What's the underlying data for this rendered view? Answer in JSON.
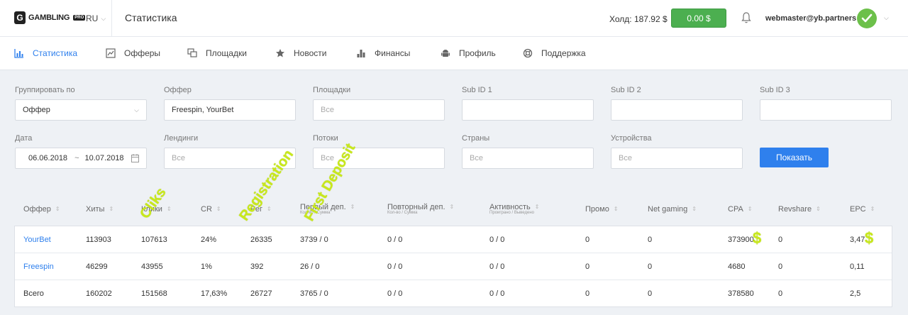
{
  "header": {
    "logo_text": "GAMBLING",
    "logo_badge": "PRO",
    "lang": "RU",
    "page_title": "Статистика",
    "hold": "Холд: 187.92 $",
    "balance": "0.00 $",
    "user": "webmaster@yb.partners"
  },
  "nav": [
    {
      "label": "Статистика",
      "icon": "bar-chart-icon"
    },
    {
      "label": "Офферы",
      "icon": "chart-window-icon"
    },
    {
      "label": "Площадки",
      "icon": "windows-icon"
    },
    {
      "label": "Новости",
      "icon": "star-icon"
    },
    {
      "label": "Финансы",
      "icon": "bars-icon"
    },
    {
      "label": "Профиль",
      "icon": "android-icon"
    },
    {
      "label": "Поддержка",
      "icon": "lifebuoy-icon"
    }
  ],
  "filters": {
    "group_by": {
      "label": "Группировать по",
      "value": "Оффер"
    },
    "offer": {
      "label": "Оффер",
      "value": "Freespin, YourBet"
    },
    "sites": {
      "label": "Площадки",
      "placeholder": "Все"
    },
    "sub1": {
      "label": "Sub ID 1"
    },
    "sub2": {
      "label": "Sub ID 2"
    },
    "sub3": {
      "label": "Sub ID 3"
    },
    "date": {
      "label": "Дата",
      "from": "06.06.2018",
      "sep": "~",
      "to": "10.07.2018"
    },
    "landings": {
      "label": "Лендинги",
      "placeholder": "Все"
    },
    "streams": {
      "label": "Потоки",
      "placeholder": "Все"
    },
    "countries": {
      "label": "Страны",
      "placeholder": "Все"
    },
    "devices": {
      "label": "Устройства",
      "placeholder": "Все"
    },
    "show_button": "Показать"
  },
  "table": {
    "headers": [
      "Оффер",
      "Хиты",
      "Клики",
      "CR",
      "Рег",
      "Первый деп.",
      "Повторный деп.",
      "Активность",
      "Промо",
      "Net gaming",
      "CPA",
      "Revshare",
      "EPC"
    ],
    "subheaders": {
      "first_dep": "Кол-во / Сумма",
      "repeat_dep": "Кол-во / Сумма",
      "activity": "Проиграно / Выведено"
    },
    "rows": [
      [
        "YourBet",
        "113903",
        "107613",
        "24%",
        "26335",
        "3739 / 0",
        "0 / 0",
        "0 / 0",
        "0",
        "0",
        "373900",
        "0",
        "3,47"
      ],
      [
        "Freespin",
        "46299",
        "43955",
        "1%",
        "392",
        "26 / 0",
        "0 / 0",
        "0 / 0",
        "0",
        "0",
        "4680",
        "0",
        "0,11"
      ],
      [
        "Всего",
        "160202",
        "151568",
        "17,63%",
        "26727",
        "3765 / 0",
        "0 / 0",
        "0 / 0",
        "0",
        "0",
        "378580",
        "0",
        "2,5"
      ]
    ]
  },
  "annotations": {
    "cliks": "Cliks",
    "registration": "Registration",
    "first_deposit": "First Deposit",
    "dollar": "$"
  },
  "colors": {
    "accent": "#2f80ed",
    "success": "#4caf50",
    "annotation": "#c8e81c"
  }
}
